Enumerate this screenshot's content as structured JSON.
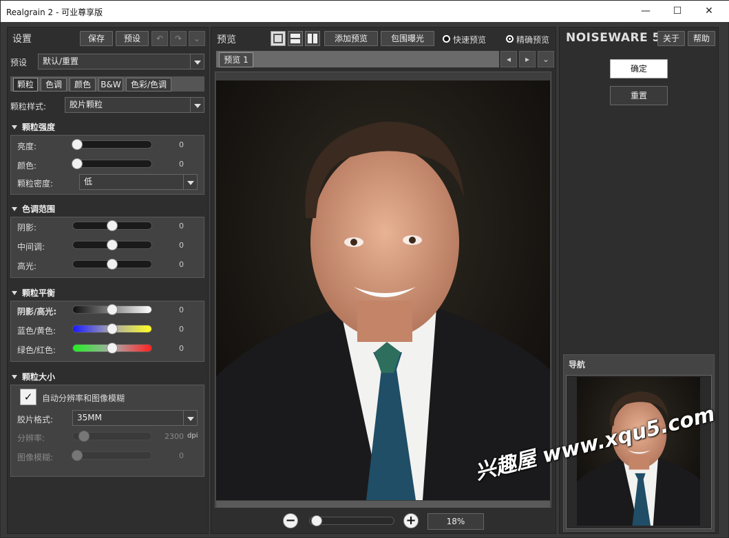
{
  "window": {
    "title": "Realgrain 2 - 可业尊享版",
    "minimize": "—",
    "maximize": "☐",
    "close": "✕"
  },
  "left": {
    "header": "设置",
    "save": "保存",
    "preset_btn": "预设",
    "preset_label": "预设",
    "preset_value": "默认/重置",
    "tabs": [
      "颗粒",
      "色调",
      "颜色",
      "B&W",
      "色彩/色调"
    ],
    "grain_style_label": "颗粒样式:",
    "grain_style_value": "胶片颗粒",
    "strength": {
      "title": "颗粒强度",
      "brightness_label": "亮度:",
      "brightness_value": "0",
      "color_label": "颜色:",
      "color_value": "0",
      "density_label": "颗粒密度:",
      "density_value": "低"
    },
    "tone": {
      "title": "色调范围",
      "shadow_label": "阴影:",
      "shadow_value": "0",
      "mid_label": "中间调:",
      "mid_value": "0",
      "high_label": "高光:",
      "high_value": "0"
    },
    "balance": {
      "title": "颗粒平衡",
      "sh_label": "阴影/高光:",
      "sh_value": "0",
      "by_label": "蓝色/黄色:",
      "by_value": "0",
      "gr_label": "绿色/红色:",
      "gr_value": "0"
    },
    "size": {
      "title": "颗粒大小",
      "auto_label": "自动分辨率和图像模糊",
      "film_label": "胶片格式:",
      "film_value": "35MM",
      "res_label": "分辨率:",
      "res_value": "2300",
      "res_unit": "dpi",
      "blur_label": "图像模糊:",
      "blur_value": "0"
    }
  },
  "center": {
    "header": "预览",
    "add_preview": "添加预览",
    "clip_exposure": "包围曝光",
    "fast_preview": "快速预览",
    "accurate_preview": "精确预览",
    "preview_tab": "预览 1",
    "zoom": "18%"
  },
  "right": {
    "brand": "NOISEWARE 5",
    "about": "关于",
    "help": "帮助",
    "ok": "确定",
    "reset": "重置",
    "nav_title": "导航"
  },
  "watermark": "兴趣屋 www.xqu5.com"
}
